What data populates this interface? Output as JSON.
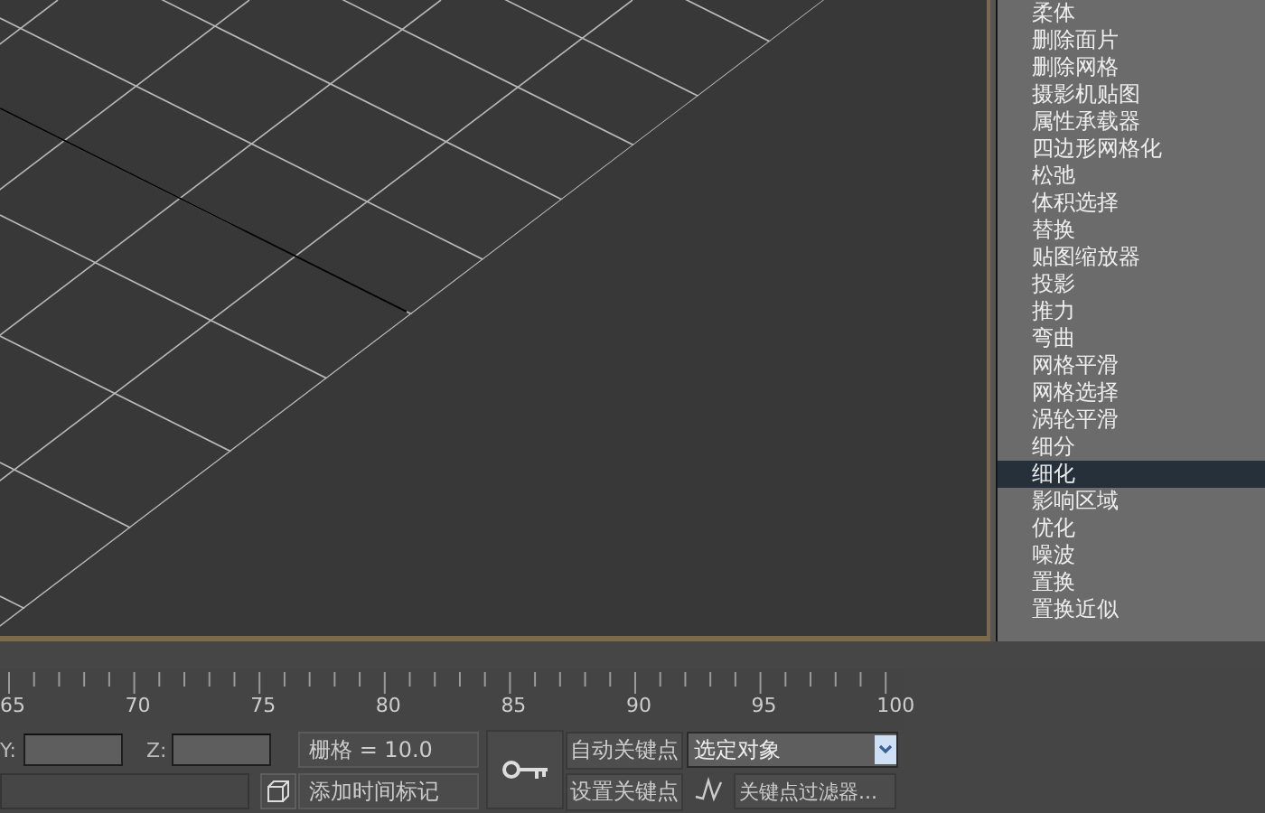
{
  "modifier_list": {
    "items": [
      {
        "label": "柔体",
        "selected": false
      },
      {
        "label": "删除面片",
        "selected": false
      },
      {
        "label": "删除网格",
        "selected": false
      },
      {
        "label": "摄影机贴图",
        "selected": false
      },
      {
        "label": "属性承载器",
        "selected": false
      },
      {
        "label": "四边形网格化",
        "selected": false
      },
      {
        "label": "松弛",
        "selected": false
      },
      {
        "label": "体积选择",
        "selected": false
      },
      {
        "label": "替换",
        "selected": false
      },
      {
        "label": "贴图缩放器",
        "selected": false
      },
      {
        "label": "投影",
        "selected": false
      },
      {
        "label": "推力",
        "selected": false
      },
      {
        "label": "弯曲",
        "selected": false
      },
      {
        "label": "网格平滑",
        "selected": false
      },
      {
        "label": "网格选择",
        "selected": false
      },
      {
        "label": "涡轮平滑",
        "selected": false
      },
      {
        "label": "细分",
        "selected": false
      },
      {
        "label": "细化",
        "selected": true
      },
      {
        "label": "影响区域",
        "selected": false
      },
      {
        "label": "优化",
        "selected": false
      },
      {
        "label": "噪波",
        "selected": false
      },
      {
        "label": "置换",
        "selected": false
      },
      {
        "label": "置换近似",
        "selected": false
      }
    ]
  },
  "timeline": {
    "labels": [
      "65",
      "70",
      "75",
      "80",
      "85",
      "90",
      "95",
      "100"
    ]
  },
  "status": {
    "y_label": "Y:",
    "z_label": "Z:",
    "grid": "栅格 = 10.0",
    "time_tag": "添加时间标记"
  },
  "animation": {
    "auto_key": "自动关键点",
    "set_key": "设置关键点",
    "selection": "选定对象",
    "key_filters": "关键点过滤器..."
  }
}
